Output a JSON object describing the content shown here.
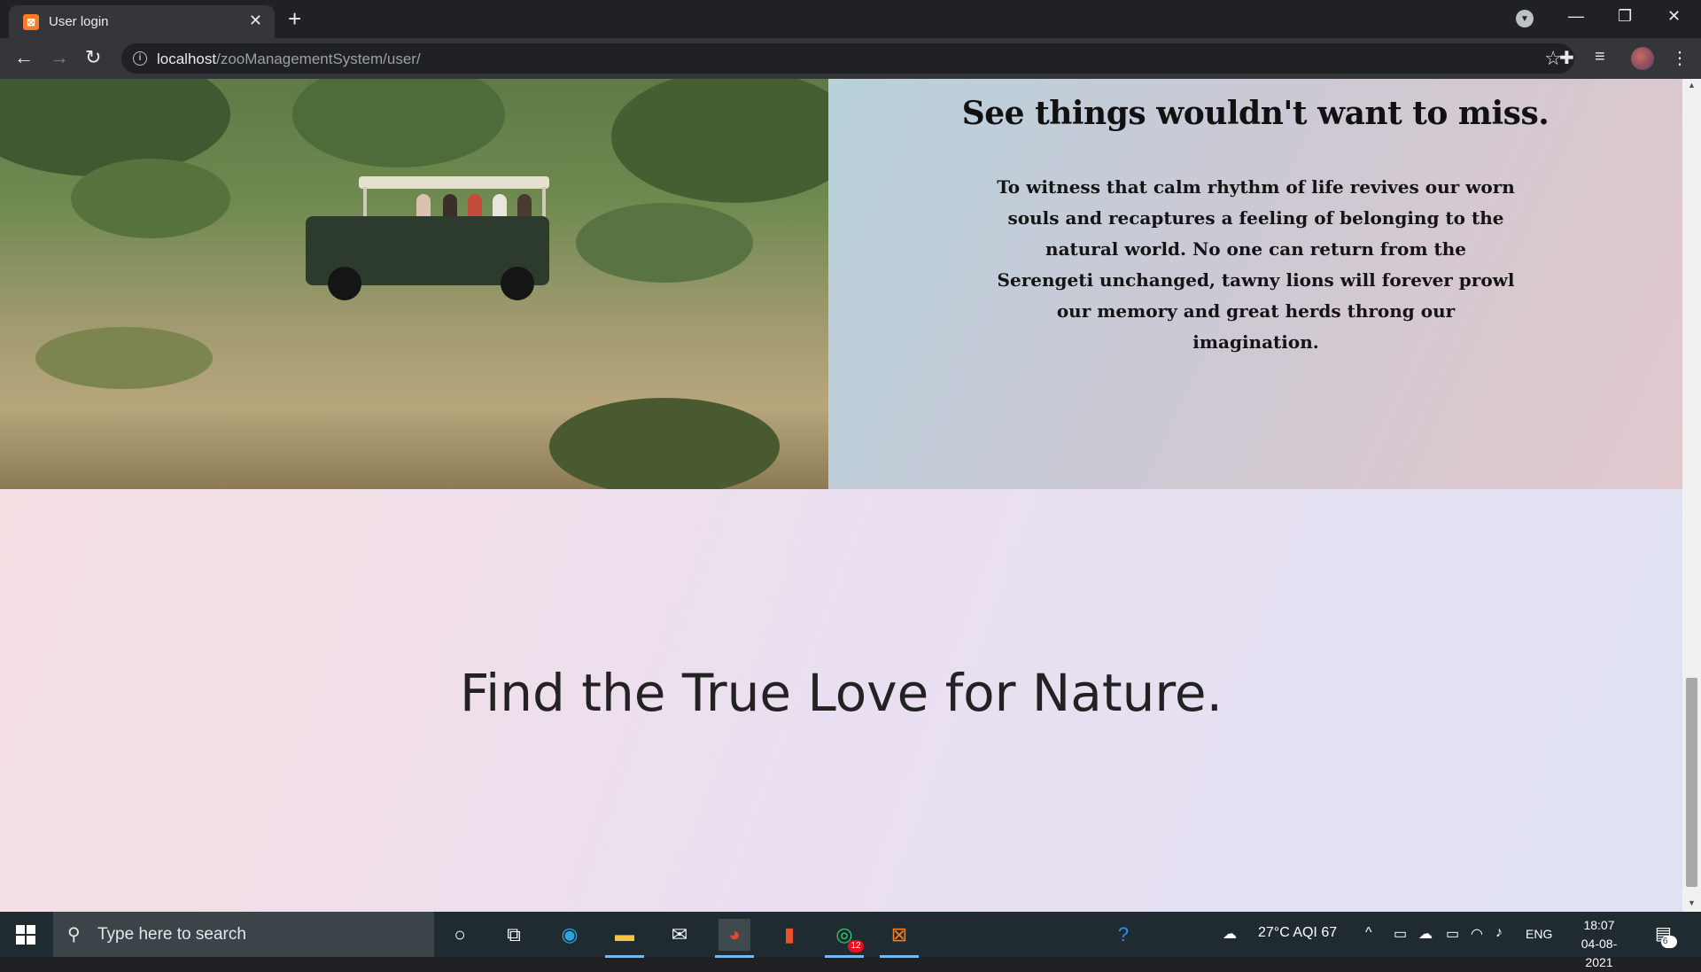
{
  "browser": {
    "tab_title": "User login",
    "favicon_glyph": "⊠",
    "url_host": "localhost",
    "url_path": "/zooManagementSystem/user/"
  },
  "page": {
    "feature_heading": "See things wouldn't want to miss.",
    "feature_text": "To witness that calm rhythm of life revives our worn souls and recaptures a feeling of belonging to the natural world. No one can return from the Serengeti unchanged, tawny lions will forever prowl our memory and great herds throng our imagination.",
    "banner_heading": "Find the True Love for Nature."
  },
  "taskbar": {
    "search_placeholder": "Type here to search",
    "whatsapp_badge": "12",
    "weather": "27°C  AQI 67",
    "language": "ENG",
    "time": "18:07",
    "date": "04-08-2021",
    "notification_count": "6"
  },
  "colors": {
    "chrome_dark": "#202124",
    "chrome_toolbar": "#35363a",
    "xampp_orange": "#fb7a24",
    "taskbar": "#1f2b30"
  }
}
